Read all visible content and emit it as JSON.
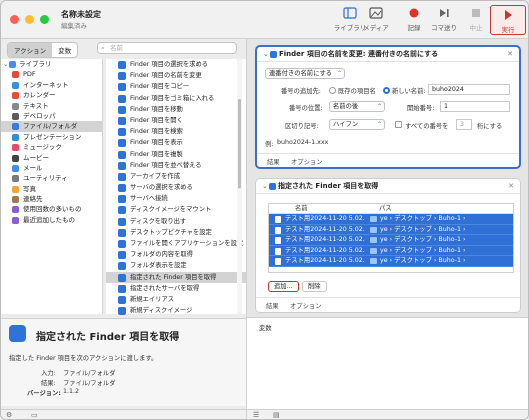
{
  "window": {
    "title": "名称未設定",
    "subtitle": "編集済み"
  },
  "toolbar": {
    "library": "ライブラリ",
    "media": "メディア",
    "record": "記録",
    "step": "コマ送り",
    "stop": "中止",
    "run": "実行"
  },
  "left": {
    "tab_actions": "アクション",
    "tab_variables": "変数",
    "search_placeholder": "名前",
    "library": [
      {
        "label": "ライブラリ",
        "color": "#4a90d9"
      },
      {
        "label": "PDF",
        "color": "#e04b3c"
      },
      {
        "label": "インターネット",
        "color": "#3a8ee6"
      },
      {
        "label": "カレンダー",
        "color": "#e94b3c"
      },
      {
        "label": "テキスト",
        "color": "#8a8a8a"
      },
      {
        "label": "デベロッパ",
        "color": "#5a5a5a"
      },
      {
        "label": "ファイル/フォルダ",
        "color": "#3b7bd6"
      },
      {
        "label": "プレゼンテーション",
        "color": "#2f8fd8"
      },
      {
        "label": "ミュージック",
        "color": "#f04868"
      },
      {
        "label": "ムービー",
        "color": "#444444"
      },
      {
        "label": "メール",
        "color": "#3d8ef0"
      },
      {
        "label": "ユーティリティ",
        "color": "#7a7a7a"
      },
      {
        "label": "写真",
        "color": "#f2a53a"
      },
      {
        "label": "連絡先",
        "color": "#a07a52"
      },
      {
        "label": "使用回数の多いもの",
        "color": "#8a5ed6"
      },
      {
        "label": "最近追加したもの",
        "color": "#8a5ed6"
      }
    ],
    "actions": [
      "Finder 項目の選択を求める",
      "Finder 項目の名前を変更",
      "Finder 項目をコピー",
      "Finder 項目をゴミ箱に入れる",
      "Finder 項目を移動",
      "Finder 項目を開く",
      "Finder 項目を検索",
      "Finder 項目を表示",
      "Finder 項目を複製",
      "Finder 項目を並べ替える",
      "アーカイブを作成",
      "サーバの選択を求める",
      "サーバへ接続",
      "ディスクイメージをマウント",
      "ディスクを取り出す",
      "デスクトップピクチャを設定",
      "ファイルを開くアプリケーションを設定",
      "フォルダの内容を取得",
      "フォルダ表示を設定",
      "指定された Finder 項目を取得",
      "指定されたサーバを取得",
      "新規エイリアス",
      "新規ディスクイメージ"
    ],
    "desc": {
      "title": "指定された Finder 項目を取得",
      "text": "指定した Finder 項目を次のアクションに渡します。",
      "input_label": "入力:",
      "input_value": "ファイル/フォルダ",
      "result_label": "結果:",
      "result_value": "ファイル/フォルダ",
      "version_label": "バージョン:",
      "version_value": "1.1.2"
    }
  },
  "rename": {
    "title": "Finder 項目の名前を変更: 連番付きの名前にする",
    "mode": "連番付きの名前にする",
    "add_number_label": "番号の追加先:",
    "radio_existing": "既存の項目名",
    "radio_new": "新しい名前:",
    "new_name": "buho2024",
    "position_label": "番号の位置:",
    "position": "名前の後",
    "start_label": "開始番号:",
    "start": "1",
    "separator_label": "区切り記号:",
    "separator": "ハイフン",
    "all_numbers_label": "すべての番号を",
    "digits": "3",
    "digits_suffix": "桁にする",
    "example_label": "例:",
    "example": "buho2024-1.xxx",
    "tab_results": "結果",
    "tab_options": "オプション"
  },
  "finder": {
    "title": "指定された Finder 項目を取得",
    "col_name": "名前",
    "col_path": "パス",
    "rows": [
      {
        "name": "テスト用2024-11-20 5.02.",
        "path": "ye › デスクトップ › Buho-1 ›"
      },
      {
        "name": "テスト用2024-11-20 5.02.",
        "path": "ye › デスクトップ › Buho-1 ›"
      },
      {
        "name": "テスト用2024-11-20 5.02.",
        "path": "ye › デスクトップ › Buho-1 ›"
      },
      {
        "name": "テスト用2024-11-20 5.02.",
        "path": "ye › デスクトップ › Buho-1 ›"
      },
      {
        "name": "テスト用2024-11-20 5.02.",
        "path": "ye › デスクトップ › Buho-1 ›"
      }
    ],
    "add_button": "追加...",
    "delete_button": "削除",
    "tab_results": "結果",
    "tab_options": "オプション"
  },
  "variables": {
    "label": "変数"
  },
  "colors": {
    "accent": "#2f6fd6",
    "run": "#c0392b",
    "record": "#e0302a"
  }
}
